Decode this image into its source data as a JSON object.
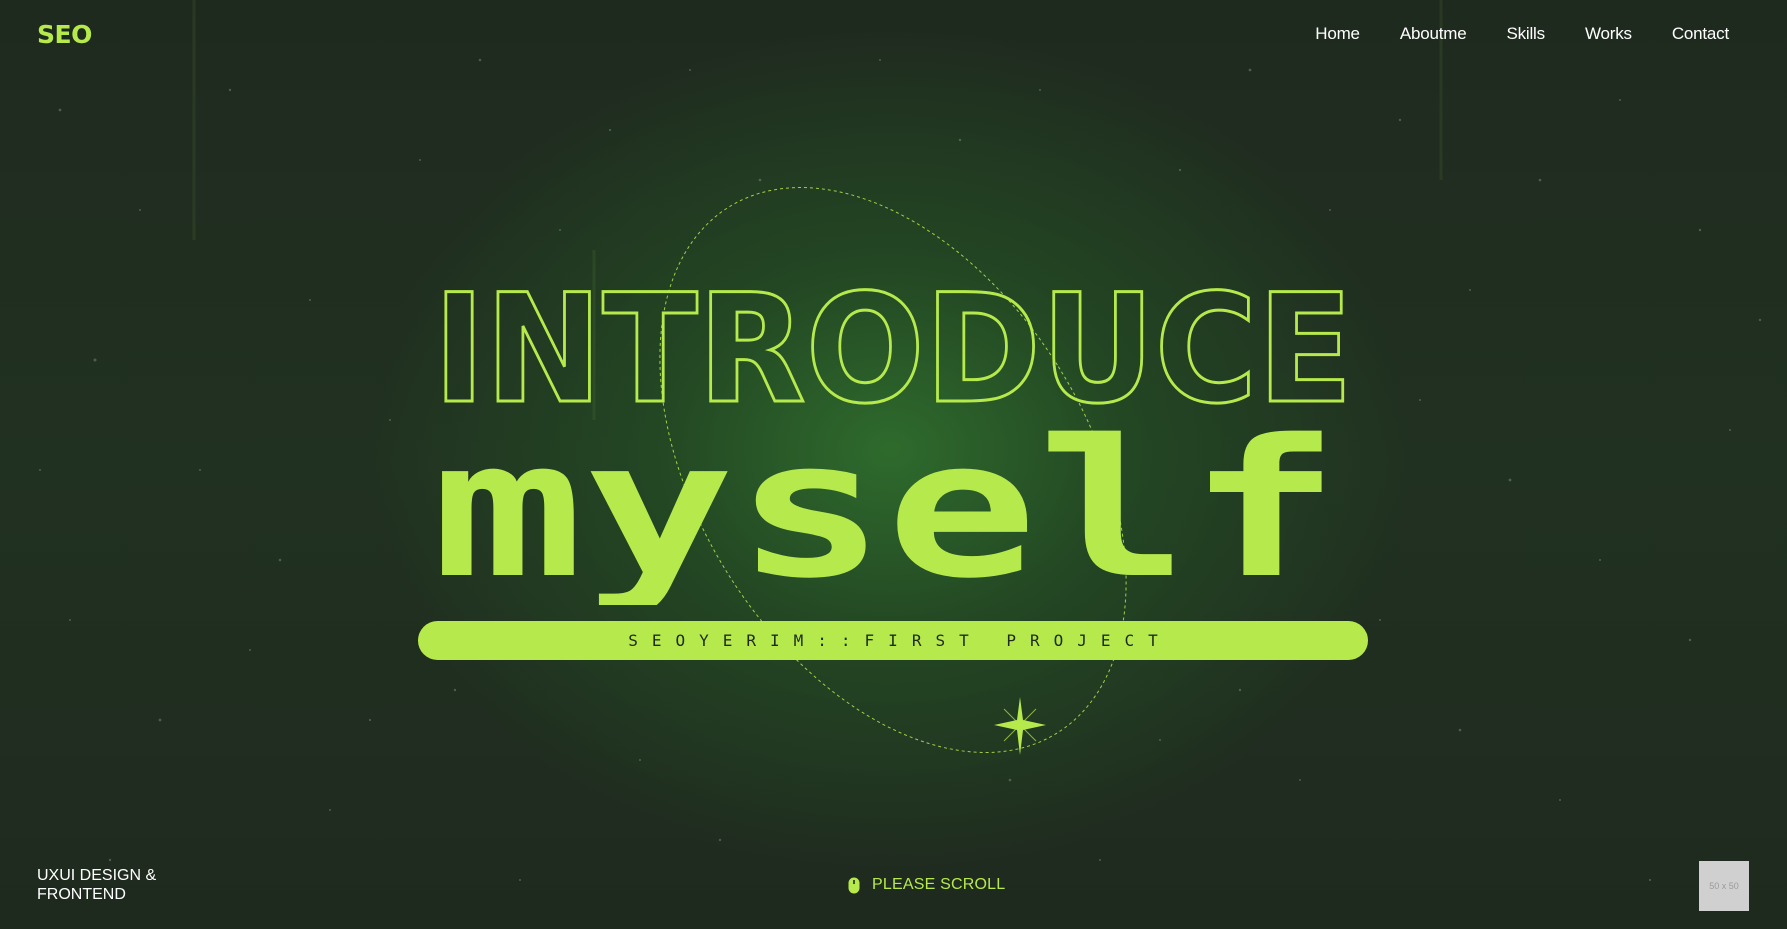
{
  "header": {
    "logo": "SEO",
    "nav": [
      "Home",
      "Aboutme",
      "Skills",
      "Works",
      "Contact"
    ]
  },
  "hero": {
    "title_outline": "INTRODUCE",
    "title_solid": "myself",
    "pill_text": "SEOYERIM::FIRST PROJECT"
  },
  "footer": {
    "tagline_line1": "UXUI DESIGN &",
    "tagline_line2": "FRONTEND",
    "scroll_label": "PLEASE SCROLL",
    "placeholder_label": "50 x 50"
  },
  "colors": {
    "accent": "#b6ea4c",
    "background": "#1e2a1e",
    "glow": "#2f6e2d",
    "text": "#ffffff"
  },
  "icons": {
    "scroll": "mouse-icon",
    "sparkle": "sparkle-star-icon"
  }
}
